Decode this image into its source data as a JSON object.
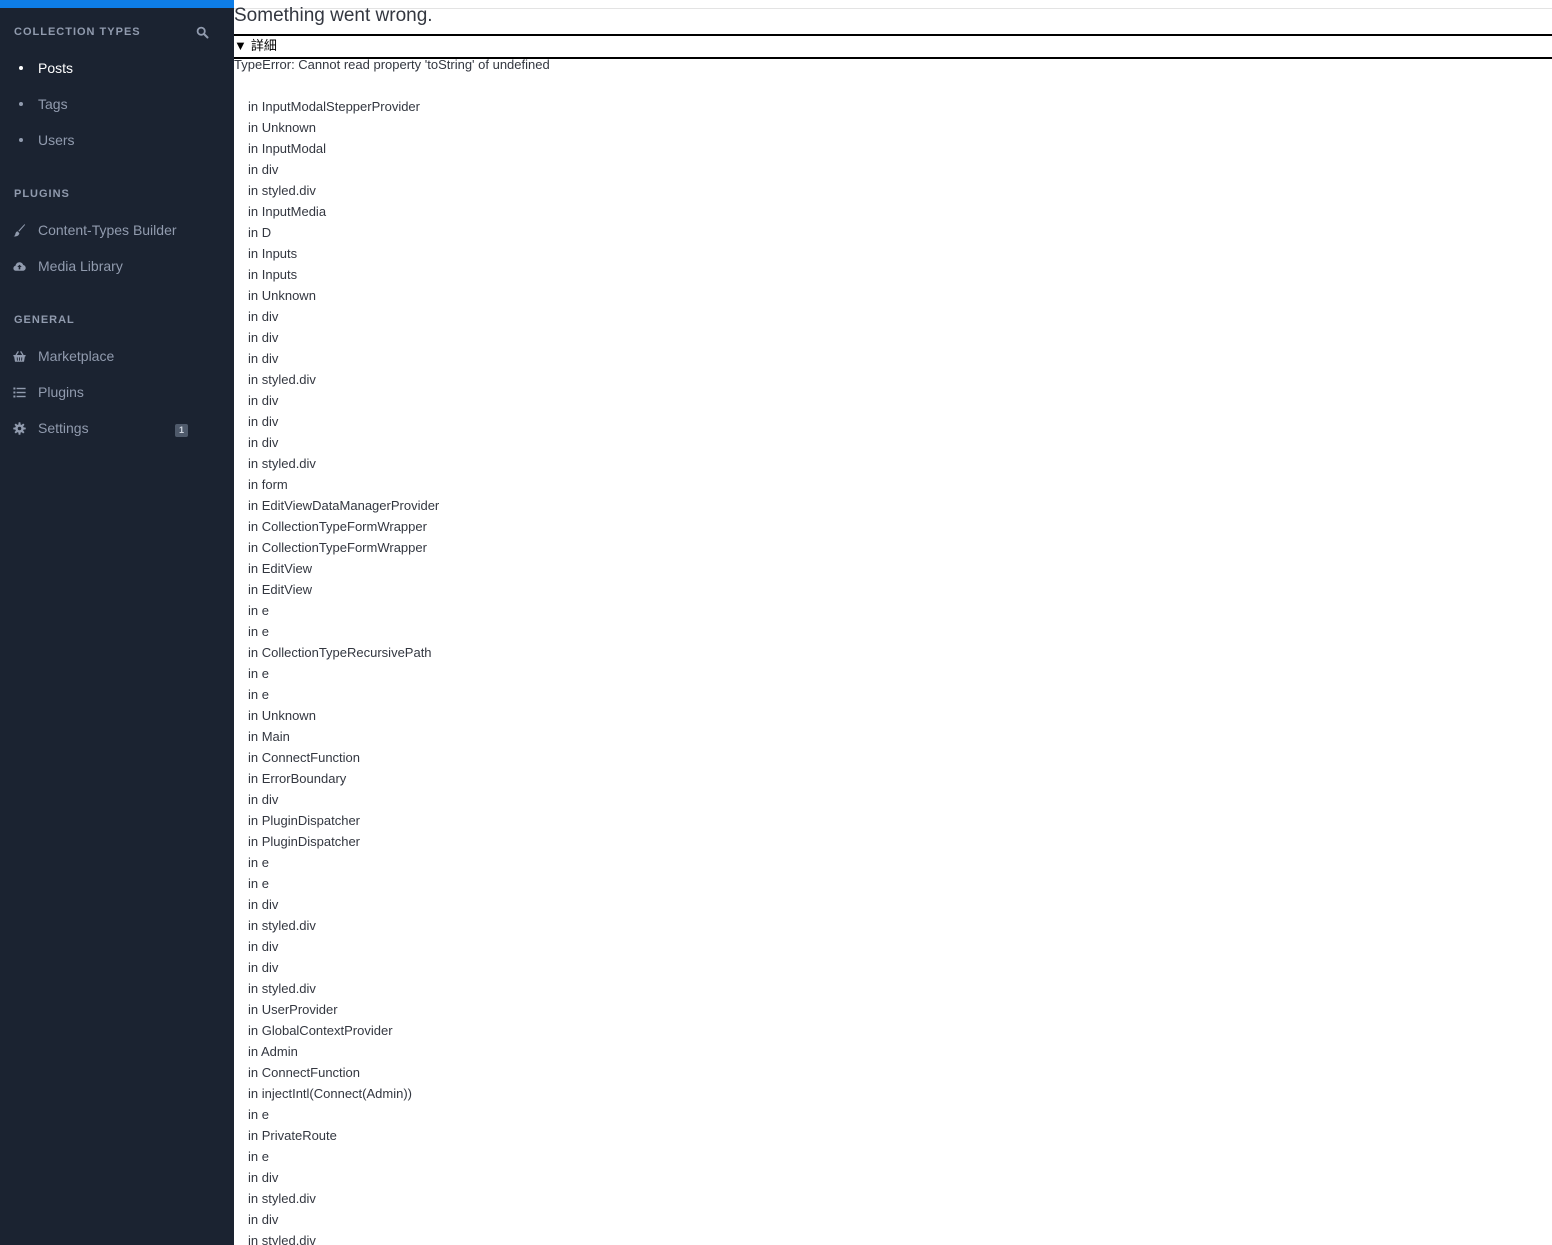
{
  "sidebar": {
    "collection_types_title": "COLLECTION TYPES",
    "collection_types": [
      {
        "label": "Posts",
        "active": true
      },
      {
        "label": "Tags",
        "active": false
      },
      {
        "label": "Users",
        "active": false
      }
    ],
    "plugins_title": "PLUGINS",
    "plugins": [
      {
        "label": "Content-Types Builder",
        "icon": "paintbrush-icon"
      },
      {
        "label": "Media Library",
        "icon": "cloud-upload-icon"
      }
    ],
    "general_title": "GENERAL",
    "general": [
      {
        "label": "Marketplace",
        "icon": "basket-icon"
      },
      {
        "label": "Plugins",
        "icon": "list-icon"
      },
      {
        "label": "Settings",
        "icon": "gear-icon",
        "badge": "1"
      }
    ]
  },
  "error": {
    "title": "Something went wrong.",
    "details_arrow": "▼",
    "details_label": "詳細",
    "message": "TypeError: Cannot read property 'toString' of undefined",
    "stack": [
      "in InputModalStepperProvider",
      "in Unknown",
      "in InputModal",
      "in div",
      "in styled.div",
      "in InputMedia",
      "in D",
      "in Inputs",
      "in Inputs",
      "in Unknown",
      "in div",
      "in div",
      "in div",
      "in styled.div",
      "in div",
      "in div",
      "in div",
      "in styled.div",
      "in form",
      "in EditViewDataManagerProvider",
      "in CollectionTypeFormWrapper",
      "in CollectionTypeFormWrapper",
      "in EditView",
      "in EditView",
      "in e",
      "in e",
      "in CollectionTypeRecursivePath",
      "in e",
      "in e",
      "in Unknown",
      "in Main",
      "in ConnectFunction",
      "in ErrorBoundary",
      "in div",
      "in PluginDispatcher",
      "in PluginDispatcher",
      "in e",
      "in e",
      "in div",
      "in styled.div",
      "in div",
      "in div",
      "in styled.div",
      "in UserProvider",
      "in GlobalContextProvider",
      "in Admin",
      "in ConnectFunction",
      "in injectIntl(Connect(Admin))",
      "in e",
      "in PrivateRoute",
      "in e",
      "in div",
      "in styled.div",
      "in div",
      "in styled.div"
    ]
  },
  "colors": {
    "sidebar_bg": "#1b2331",
    "accent": "#0e7de7",
    "muted_text": "#919bae"
  }
}
